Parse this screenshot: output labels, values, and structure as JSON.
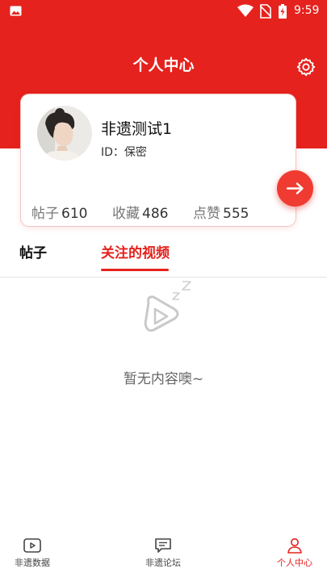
{
  "status_bar": {
    "time": "9:59"
  },
  "header": {
    "title": "个人中心"
  },
  "profile": {
    "name": "非遗测试1",
    "id_line": "ID：保密",
    "stats": [
      {
        "label": "帖子",
        "value": "610"
      },
      {
        "label": "收藏",
        "value": "486"
      },
      {
        "label": "点赞",
        "value": "555"
      }
    ]
  },
  "tabs": [
    {
      "label": "帖子",
      "active": false
    },
    {
      "label": "关注的视频",
      "active": true
    }
  ],
  "empty_state": {
    "text": "暂无内容噢~",
    "icon": "video-sleep-icon"
  },
  "bottom_nav": [
    {
      "label": "非遗数据",
      "icon": "video-icon",
      "active": false
    },
    {
      "label": "非遗论坛",
      "icon": "chat-icon",
      "active": false
    },
    {
      "label": "个人中心",
      "icon": "person-icon",
      "active": true
    }
  ],
  "colors": {
    "accent": "#e5221d",
    "arrow_button": "#ef3b32"
  }
}
